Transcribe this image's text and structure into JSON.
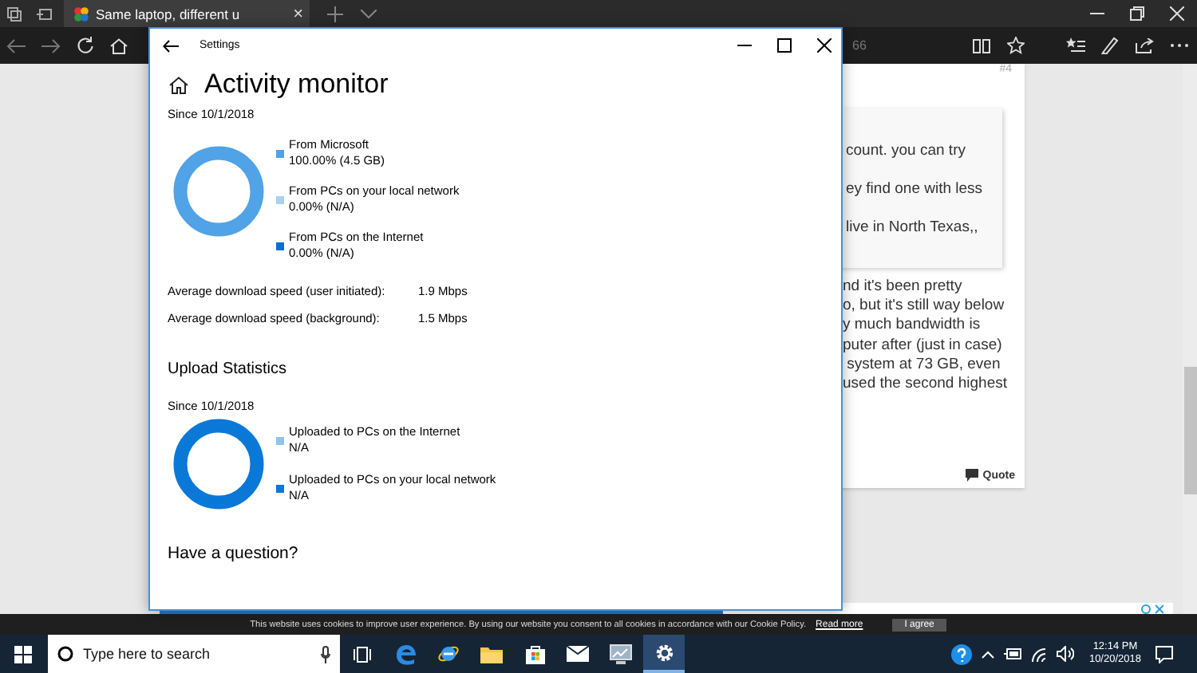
{
  "browser": {
    "tab_title": "Same laptop, different u",
    "tab_close": "×",
    "address": "66"
  },
  "post": {
    "number": "#4",
    "quote_lines": [
      "count. you can try",
      "ey find one with less",
      "live in North Texas,,"
    ],
    "body_lines": [
      "nd it's been pretty",
      "o, but it's still way below",
      "y much bandwidth is",
      "puter after (just in case)",
      " system at 73 GB, even",
      "used the second highest"
    ],
    "quote_button": "Quote"
  },
  "settings": {
    "title": "Settings",
    "heading": "Activity monitor",
    "download": {
      "since": "Since 10/1/2018",
      "legend": [
        {
          "label": "From Microsoft",
          "value": "100.00%  (4.5 GB)",
          "color": "#4fa3e6"
        },
        {
          "label": "From PCs on your local network",
          "value": "0.00%  (N/A)",
          "color": "#a8d2f4"
        },
        {
          "label": "From PCs on the Internet",
          "value": "0.00%  (N/A)",
          "color": "#0a6fd0"
        }
      ],
      "stats": [
        {
          "label": "Average download speed (user initiated):",
          "value": "1.9 Mbps"
        },
        {
          "label": "Average download speed (background):",
          "value": "1.5 Mbps"
        }
      ]
    },
    "upload": {
      "heading": "Upload Statistics",
      "since": "Since 10/1/2018",
      "legend": [
        {
          "label": "Uploaded to PCs on the Internet",
          "value": "N/A",
          "color": "#8cc4ee"
        },
        {
          "label": "Uploaded to PCs on your local network",
          "value": "N/A",
          "color": "#0a78d7"
        }
      ]
    },
    "footer_heading": "Have a question?"
  },
  "cookie_bar": {
    "text": "This website uses cookies to improve user experience. By using our website you consent to all cookies in accordance with our Cookie Policy.",
    "link": "Read more",
    "button": "I agree"
  },
  "taskbar": {
    "search_placeholder": "Type here to search",
    "time": "12:14 PM",
    "date": "10/20/2018",
    "apps": [
      {
        "kind": "taskview",
        "selected": false
      },
      {
        "kind": "edge",
        "selected": false
      },
      {
        "kind": "ie",
        "selected": false
      },
      {
        "kind": "folder",
        "selected": false
      },
      {
        "kind": "store",
        "selected": false
      },
      {
        "kind": "mail",
        "selected": false
      },
      {
        "kind": "monitor",
        "selected": false
      },
      {
        "kind": "settings",
        "selected": true
      }
    ]
  }
}
